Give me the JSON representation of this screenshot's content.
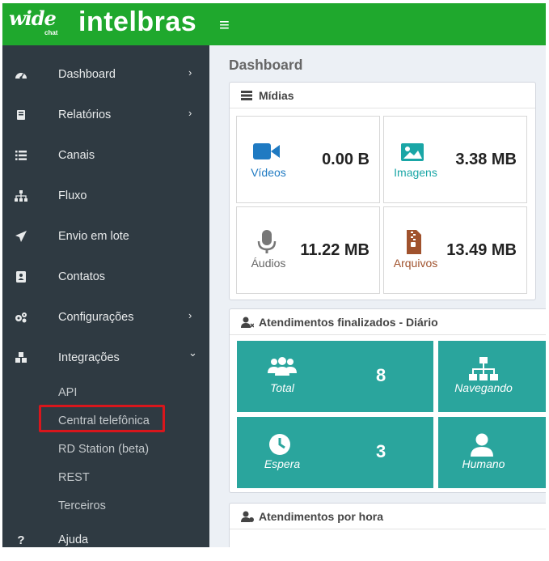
{
  "header": {
    "logo_wide": "wide",
    "logo_chat": "chat",
    "logo_brand": "intelbras",
    "menu_icon": "hamburger-icon",
    "color": "#1fa82d"
  },
  "sidebar": {
    "items": [
      {
        "label": "Dashboard",
        "icon": "dashboard-icon",
        "chevron": "›"
      },
      {
        "label": "Relatórios",
        "icon": "book-icon",
        "chevron": "›"
      },
      {
        "label": "Canais",
        "icon": "list-icon"
      },
      {
        "label": "Fluxo",
        "icon": "sitemap-icon"
      },
      {
        "label": "Envio em lote",
        "icon": "paper-plane-icon"
      },
      {
        "label": "Contatos",
        "icon": "address-book-icon"
      },
      {
        "label": "Configurações",
        "icon": "gears-icon",
        "chevron": "›"
      },
      {
        "label": "Integrações",
        "icon": "cubes-icon",
        "chevron": "⌄"
      }
    ],
    "subitems": [
      "API",
      "Central telefônica",
      "RD Station (beta)",
      "REST",
      "Terceiros"
    ],
    "help": {
      "label": "Ajuda",
      "icon": "question-icon"
    }
  },
  "main": {
    "title": "Dashboard",
    "media_panel": {
      "title": "Mídias",
      "boxes": [
        {
          "label": "Vídeos",
          "value": "0.00 B",
          "icon": "video-camera-icon",
          "color": "#1f7ac2"
        },
        {
          "label": "Imagens",
          "value": "3.38 MB",
          "icon": "image-icon",
          "color": "#1aa6a6"
        },
        {
          "label": "Áudios",
          "value": "11.22 MB",
          "icon": "microphone-icon",
          "color": "#777777"
        },
        {
          "label": "Arquivos",
          "value": "13.49 MB",
          "icon": "file-archive-icon",
          "color": "#a0522d"
        }
      ]
    },
    "daily_panel": {
      "title": "Atendimentos finalizados - Diário",
      "tiles": [
        {
          "label": "Total",
          "value": "8",
          "icon": "users-icon"
        },
        {
          "label": "Navegando",
          "value": "",
          "icon": "sitemap-icon"
        },
        {
          "label": "Espera",
          "value": "3",
          "icon": "clock-icon"
        },
        {
          "label": "Humano",
          "value": "",
          "icon": "user-icon"
        }
      ],
      "tile_color": "#2aa59d"
    },
    "hourly_panel": {
      "title": "Atendimentos por hora"
    }
  }
}
